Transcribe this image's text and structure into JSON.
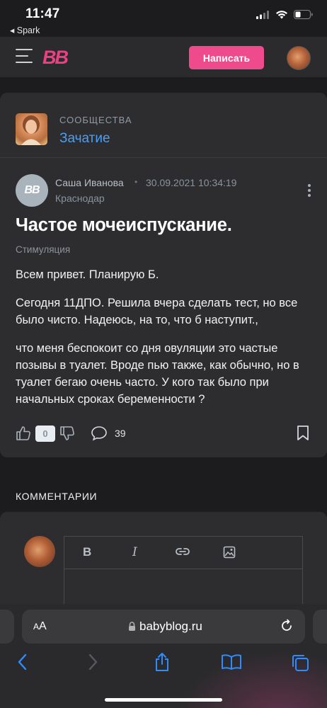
{
  "status_bar": {
    "time": "11:47",
    "back_app": "◂ Spark",
    "icons": [
      "cellular-signal-icon",
      "wifi-icon",
      "battery-icon"
    ]
  },
  "header": {
    "logo": "BB",
    "write_label": "Написать",
    "accent_color": "#ef4a8b"
  },
  "community": {
    "kicker": "СООБЩЕСТВА",
    "name": "Зачатие",
    "link_color": "#4a9ff5"
  },
  "post": {
    "author_avatar_text": "BB",
    "author": "Саша Иванова",
    "separator": "•",
    "date": "30.09.2021 10:34:19",
    "city": "Краснодар",
    "title": "Частое мочеиспускание.",
    "tag": "Стимуляция",
    "paragraphs": [
      "Всем привет. Планирую Б.",
      "Сегодня 11ДПО. Решила вчера сделать тест, но все было чисто. Надеюсь, на то, что б наступит.,",
      "что меня беспокоит со дня овуляции это частые позывы в туалет. Вроде пью также, как обычно, но в туалет бегаю очень часто. У кого так было при начальных сроках беременности ?"
    ],
    "score": "0",
    "comment_count": "39"
  },
  "comments": {
    "heading": "КОММЕНТАРИИ",
    "toolbar": {
      "bold": "B",
      "italic": "I"
    }
  },
  "safari": {
    "aa_small": "A",
    "aa_large": "A",
    "url": "babyblog.ru"
  }
}
